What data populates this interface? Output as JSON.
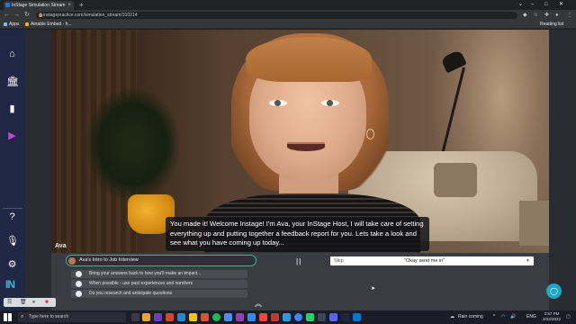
{
  "browser": {
    "tab_title": "InStage Simulation Stream",
    "url": "instagepractice.com/simulation_stream/310214",
    "bookmarks": [
      {
        "label": "Apps",
        "color": "#8ab4f8"
      },
      {
        "label": "Airtable Embed - h...",
        "color": "#fcb400"
      }
    ],
    "reading_list": "Reading list"
  },
  "sidebar": {
    "icons": [
      "home-icon",
      "bank-icon",
      "chart-icon",
      "video-icon",
      "help-icon",
      "microphone-icon",
      "settings-icon"
    ],
    "logo": "IN"
  },
  "video": {
    "speaker_tag": "Ava",
    "caption": "You made it! Welcome Instage! I'm Ava, your InStage Host, I will take care of setting everything up and putting together a feedback report for you. Lets take a look and see what you have coming up today..."
  },
  "panel": {
    "script_title": "Ava's Intro to Job Interview",
    "options": [
      "Bring your answers back to how you'll make an impact...",
      "When possible - use past experiences and numbers",
      "Do you research and anticipate questions"
    ],
    "skip_label": "Skip",
    "skip_option": "\"Okay send me in\""
  },
  "taskbar": {
    "search_placeholder": "Type here to search",
    "weather": "Rain coming",
    "lang": "ENG",
    "time": "2:57 PM",
    "date": "2/22/2022"
  },
  "colors": {
    "sidebar_bg": "#212845",
    "accent_active": "#c744d8",
    "chat_button": "#1ea6c5",
    "script_border": "#4ab08c"
  }
}
